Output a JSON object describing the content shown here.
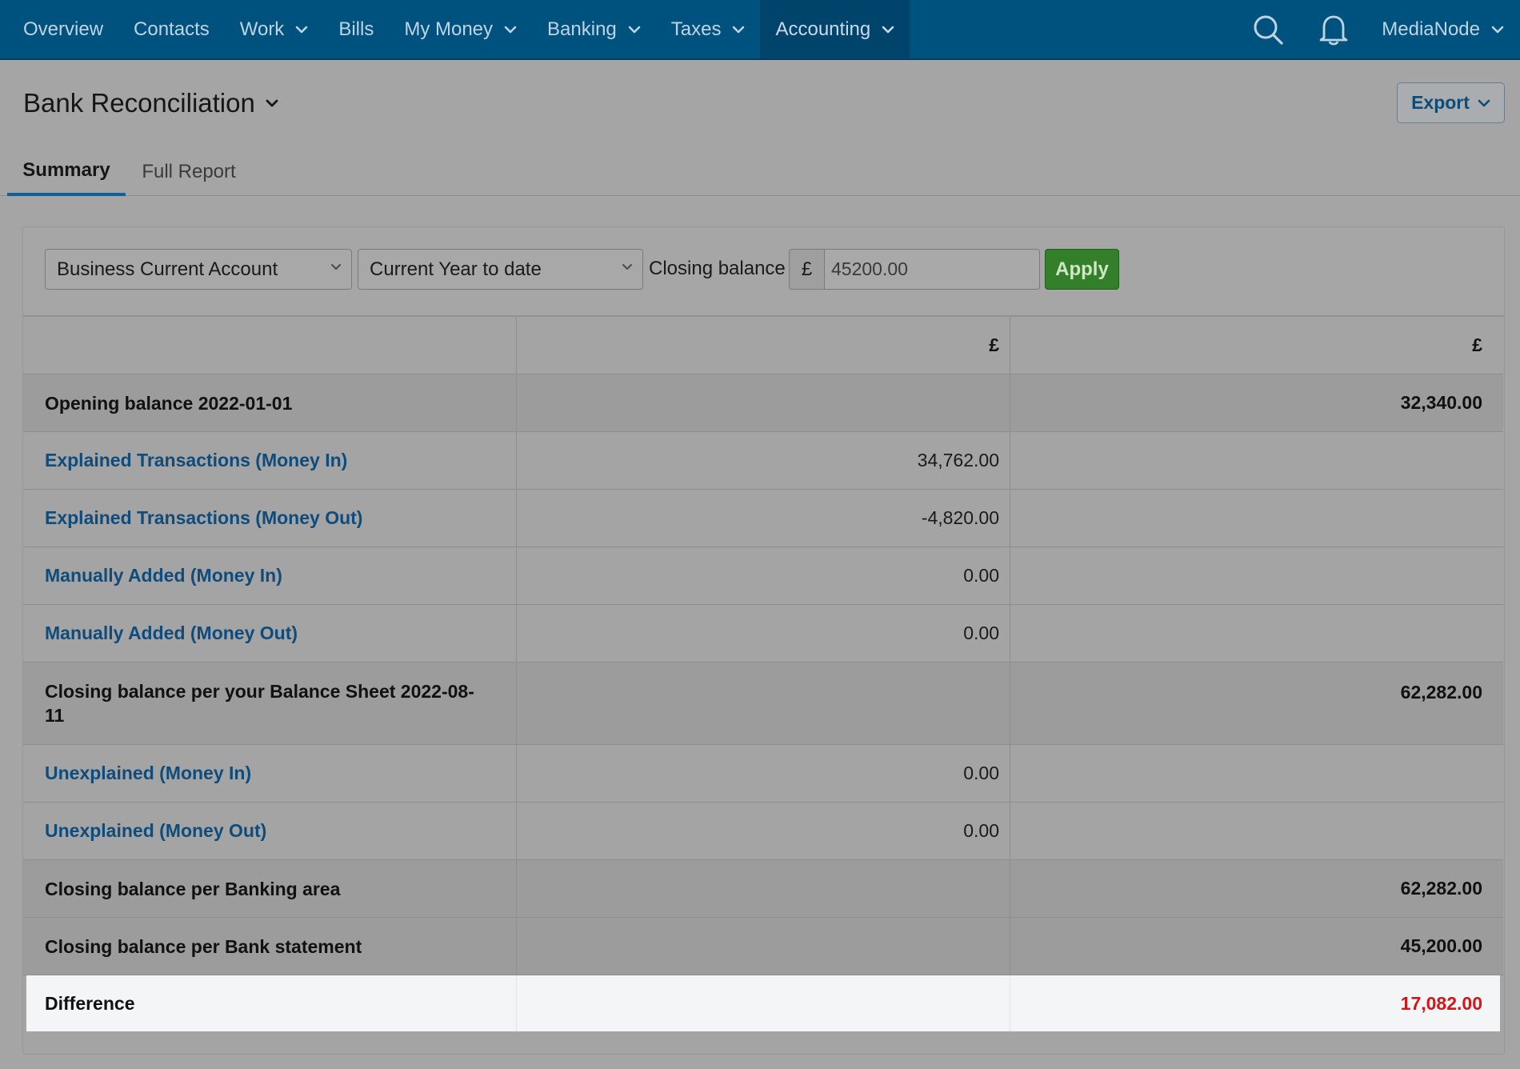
{
  "nav": {
    "items": [
      {
        "label": "Overview"
      },
      {
        "label": "Contacts"
      },
      {
        "label": "Work"
      },
      {
        "label": "Bills"
      },
      {
        "label": "My Money"
      },
      {
        "label": "Banking"
      },
      {
        "label": "Taxes"
      },
      {
        "label": "Accounting"
      }
    ],
    "active": "Accounting",
    "user": "MediaNode",
    "icons": [
      "search-icon",
      "bell-icon"
    ]
  },
  "page": {
    "title": "Bank Reconciliation",
    "export_label": "Export"
  },
  "tabs": [
    {
      "label": "Summary",
      "active": true
    },
    {
      "label": "Full Report",
      "active": false
    }
  ],
  "filters": {
    "account": "Business Current Account",
    "period": "Current Year to date",
    "closing_label": "Closing balance",
    "currency_symbol": "£",
    "closing_value": "45200.00",
    "apply_label": "Apply"
  },
  "table": {
    "currency_headers": [
      "£",
      "£"
    ],
    "rows": [
      {
        "label": "Opening balance 2022-01-01",
        "col1": "",
        "col2": "32,340.00"
      },
      {
        "label": "Explained Transactions (Money In)",
        "col1": "34,762.00",
        "col2": ""
      },
      {
        "label": "Explained Transactions (Money Out)",
        "col1": "-4,820.00",
        "col2": ""
      },
      {
        "label": "Manually Added (Money In)",
        "col1": "0.00",
        "col2": ""
      },
      {
        "label": "Manually Added (Money Out)",
        "col1": "0.00",
        "col2": ""
      },
      {
        "label": "Closing balance per your Balance Sheet 2022-08-11",
        "col1": "",
        "col2": "62,282.00"
      },
      {
        "label": "Unexplained (Money In)",
        "col1": "0.00",
        "col2": ""
      },
      {
        "label": "Unexplained (Money Out)",
        "col1": "0.00",
        "col2": ""
      },
      {
        "label": "Closing balance per Banking area",
        "col1": "",
        "col2": "62,282.00"
      },
      {
        "label": "Closing balance per Bank statement",
        "col1": "",
        "col2": "45,200.00"
      },
      {
        "label": "Difference",
        "col1": "",
        "col2": "17,082.00"
      }
    ]
  },
  "colors": {
    "nav_bg": "#00527e",
    "link": "#0f4c7c",
    "apply": "#347f2a",
    "difference": "#d11717"
  }
}
